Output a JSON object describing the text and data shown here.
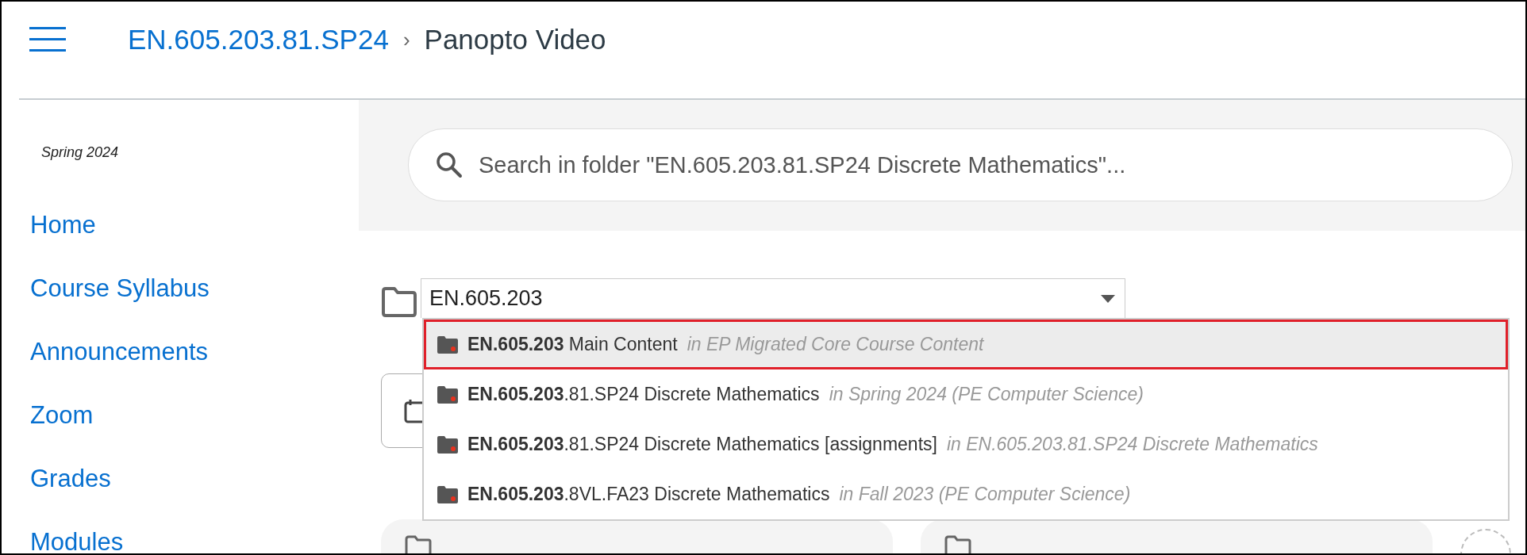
{
  "header": {
    "breadcrumb_link": "EN.605.203.81.SP24",
    "separator": "›",
    "current": "Panopto Video"
  },
  "sidebar": {
    "term": "Spring 2024",
    "items": [
      {
        "label": "Home"
      },
      {
        "label": "Course Syllabus"
      },
      {
        "label": "Announcements"
      },
      {
        "label": "Zoom"
      },
      {
        "label": "Grades"
      },
      {
        "label": "Modules"
      }
    ]
  },
  "search": {
    "placeholder": "Search in folder \"EN.605.203.81.SP24 Discrete Mathematics\"..."
  },
  "folder_select": {
    "value": "EN.605.203",
    "options": [
      {
        "title": "**EN.605.203** Main Content",
        "location": "in EP Migrated Core Course Content",
        "selected": true,
        "highlighted": true
      },
      {
        "title": "**EN.605.203**.81.SP24 Discrete Mathematics",
        "location": "in Spring 2024 (PE Computer Science)",
        "selected": false,
        "highlighted": false
      },
      {
        "title": "**EN.605.203**.81.SP24 Discrete Mathematics [assignments]",
        "location": "in EN.605.203.81.SP24 Discrete Mathematics",
        "selected": false,
        "highlighted": false
      },
      {
        "title": "**EN.605.203**.8VL.FA23 Discrete Mathematics",
        "location": "in Fall 2023 (PE Computer Science)",
        "selected": false,
        "highlighted": false
      }
    ]
  }
}
